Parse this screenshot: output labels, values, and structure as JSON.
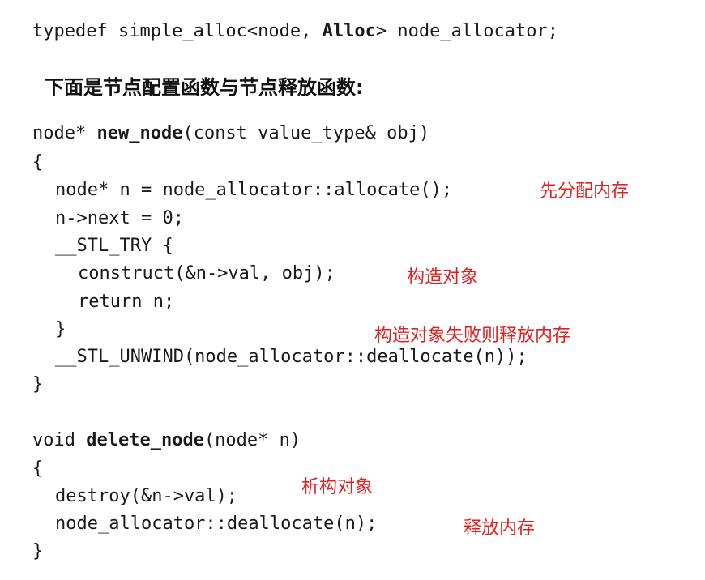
{
  "colors": {
    "code_text": "#1a1a1a",
    "annotation": "#e32020",
    "background": "#ffffff"
  },
  "typedef_line": {
    "prefix": "typedef simple_alloc<node, ",
    "bold": "Alloc",
    "suffix": "> node_allocator;"
  },
  "heading": "下面是节点配置函数与节点释放函数:",
  "new_node": {
    "sig_prefix": "node* ",
    "sig_name": "new_node",
    "sig_suffix": "(const value_type& obj)",
    "open_brace": "{",
    "line_allocate": "node* n = node_allocator::allocate();",
    "line_next": "n->next = 0;",
    "line_try": "__STL_TRY {",
    "line_construct": "construct(&n->val, obj);",
    "line_return": "return n;",
    "line_close_try": "}",
    "line_unwind": "__STL_UNWIND(node_allocator::deallocate(n));",
    "close_brace": "}"
  },
  "delete_node": {
    "sig_prefix": "void ",
    "sig_name": "delete_node",
    "sig_suffix": "(node* n)",
    "open_brace": "{",
    "line_destroy": "destroy(&n->val);",
    "line_deallocate": "node_allocator::deallocate(n);",
    "close_brace": "}"
  },
  "annotations": {
    "allocate": "先分配内存",
    "construct": "构造对象",
    "construct_fail": "构造对象失败则释放内存",
    "destroy": "析构对象",
    "release": "释放内存"
  }
}
